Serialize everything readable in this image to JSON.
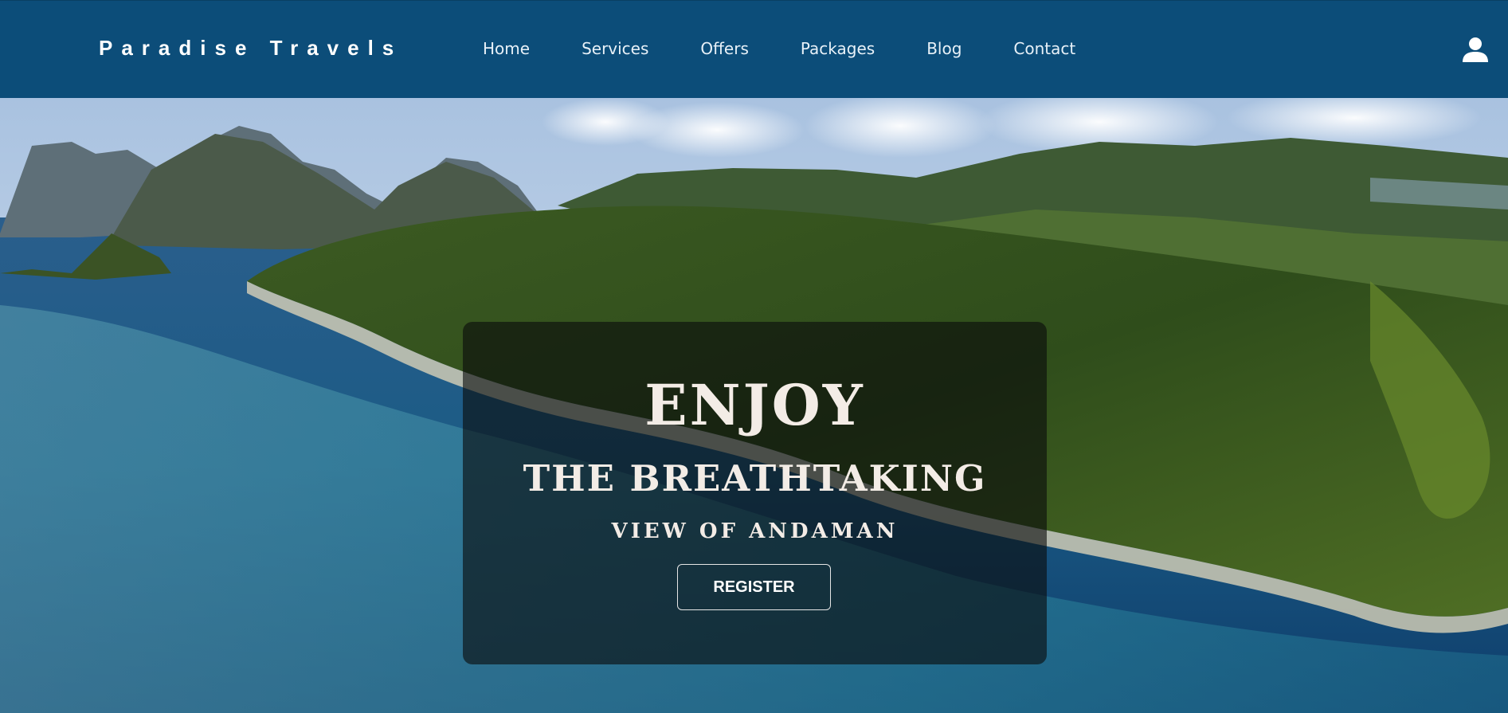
{
  "brand": {
    "name": "Paradise Travels"
  },
  "nav": {
    "items": [
      {
        "label": "Home"
      },
      {
        "label": "Services"
      },
      {
        "label": "Offers"
      },
      {
        "label": "Packages"
      },
      {
        "label": "Blog"
      },
      {
        "label": "Contact"
      }
    ],
    "user_icon": "user-icon"
  },
  "hero": {
    "line1": "ENJOY",
    "line2": "THE BREATHTAKING",
    "line3": "VIEW OF ANDAMAN",
    "cta_label": "REGISTER",
    "background": "aerial-island-photo"
  },
  "colors": {
    "navbar": "#0c4d79",
    "nav_text": "#e8f1f8",
    "hero_text": "#f3ece6"
  }
}
